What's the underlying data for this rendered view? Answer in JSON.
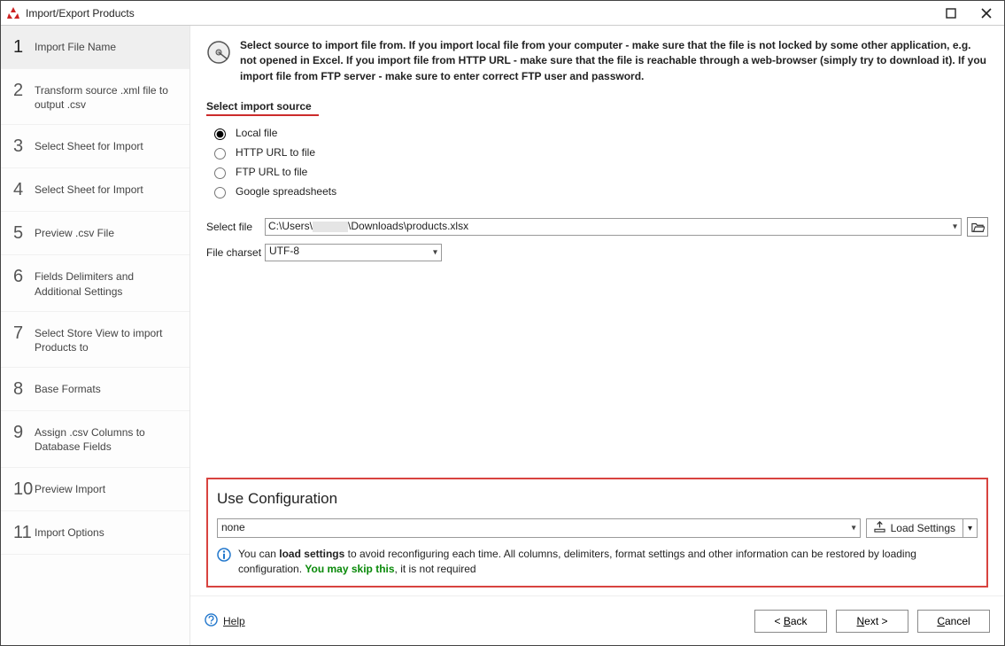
{
  "window": {
    "title": "Import/Export Products"
  },
  "sidebar": {
    "steps": [
      {
        "num": "1",
        "label": "Import File Name"
      },
      {
        "num": "2",
        "label": "Transform source .xml file to output .csv"
      },
      {
        "num": "3",
        "label": "Select Sheet for Import"
      },
      {
        "num": "4",
        "label": "Select Sheet for Import"
      },
      {
        "num": "5",
        "label": "Preview .csv File"
      },
      {
        "num": "6",
        "label": "Fields Delimiters and Additional Settings"
      },
      {
        "num": "7",
        "label": "Select Store View to import Products to"
      },
      {
        "num": "8",
        "label": "Base Formats"
      },
      {
        "num": "9",
        "label": "Assign .csv Columns to Database Fields"
      },
      {
        "num": "10",
        "label": "Preview Import"
      },
      {
        "num": "11",
        "label": "Import Options"
      }
    ],
    "active_index": 0
  },
  "main": {
    "info_text": "Select source to import file from. If you import local file from your computer - make sure that the file is not locked by some other application, e.g. not opened in Excel. If you import file from HTTP URL - make sure that the file is reachable through a web-browser (simply try to download it). If you import file from FTP server - make sure to enter correct FTP user and password.",
    "source_section_label": "Select import source",
    "source_options": {
      "local": "Local file",
      "http": "HTTP URL to file",
      "ftp": "FTP URL to file",
      "google": "Google spreadsheets"
    },
    "selected_source": "local",
    "select_file_label": "Select file",
    "file_path_prefix": "C:\\Users\\",
    "file_path_suffix": "\\Downloads\\products.xlsx",
    "charset_label": "File charset",
    "charset_value": "UTF-8"
  },
  "config": {
    "heading": "Use Configuration",
    "select_value": "none",
    "load_button": "Load Settings",
    "note_prefix": "You can ",
    "note_bold": "load settings",
    "note_mid": " to avoid reconfiguring each time. All columns, delimiters, format settings and other information can be restored by loading configuration. ",
    "note_green": "You may skip this",
    "note_suffix": ", it is not required"
  },
  "footer": {
    "help": "Help",
    "back": "Back",
    "next": "Next >",
    "cancel": "Cancel"
  }
}
